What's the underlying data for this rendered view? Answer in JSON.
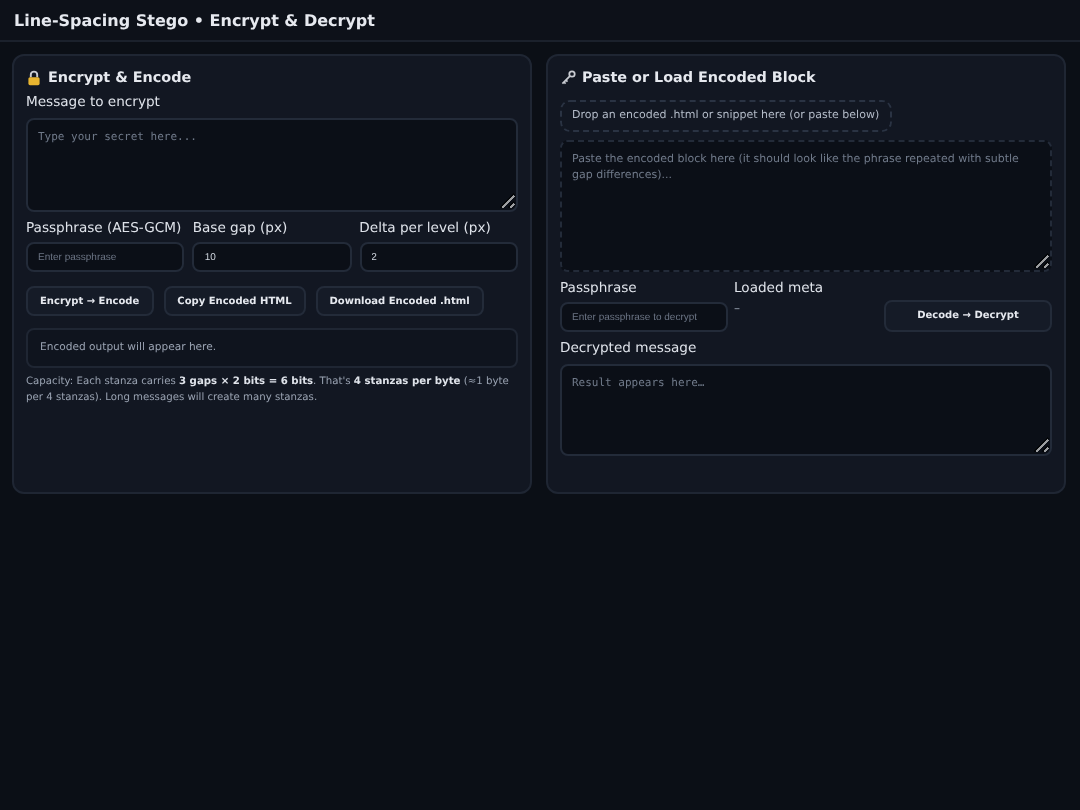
{
  "header": {
    "title": "Line-Spacing Stego • Encrypt & Decrypt"
  },
  "encrypt": {
    "title": "Encrypt & Encode",
    "message_label": "Message to encrypt",
    "message_placeholder": "Type your secret here...",
    "fields": [
      {
        "label": "Passphrase (AES-GCM)",
        "placeholder": "Enter passphrase"
      },
      {
        "label": "Base gap (px)",
        "value": "10"
      },
      {
        "label": "Delta per level (px)",
        "value": "2"
      }
    ],
    "buttons": [
      "Encrypt → Encode",
      "Copy Encoded HTML",
      "Download Encoded .html"
    ],
    "output": "Encoded output will appear here.",
    "capacity": "Capacity: Each stanza carries **3 gaps × 2 bits = 6 bits**. That's **4 stanzas per byte** (≈1 byte per 4 stanzas). Long messages will create many stanzas."
  },
  "decrypt": {
    "title": "Paste or Load Encoded Block",
    "dropzone": "Drop an encoded .html or snippet here (or paste below)",
    "paste_placeholder": "Paste the encoded block here (it should look like the phrase repeated with subtle gap differences)...",
    "passphrase_label": "Passphrase",
    "passphrase_placeholder": "Enter passphrase to decrypt",
    "meta_label": "Loaded meta",
    "meta_value": "–",
    "button": "Decode → Decrypt",
    "result_label": "Decrypted message",
    "result_placeholder": "Result appears here…"
  }
}
